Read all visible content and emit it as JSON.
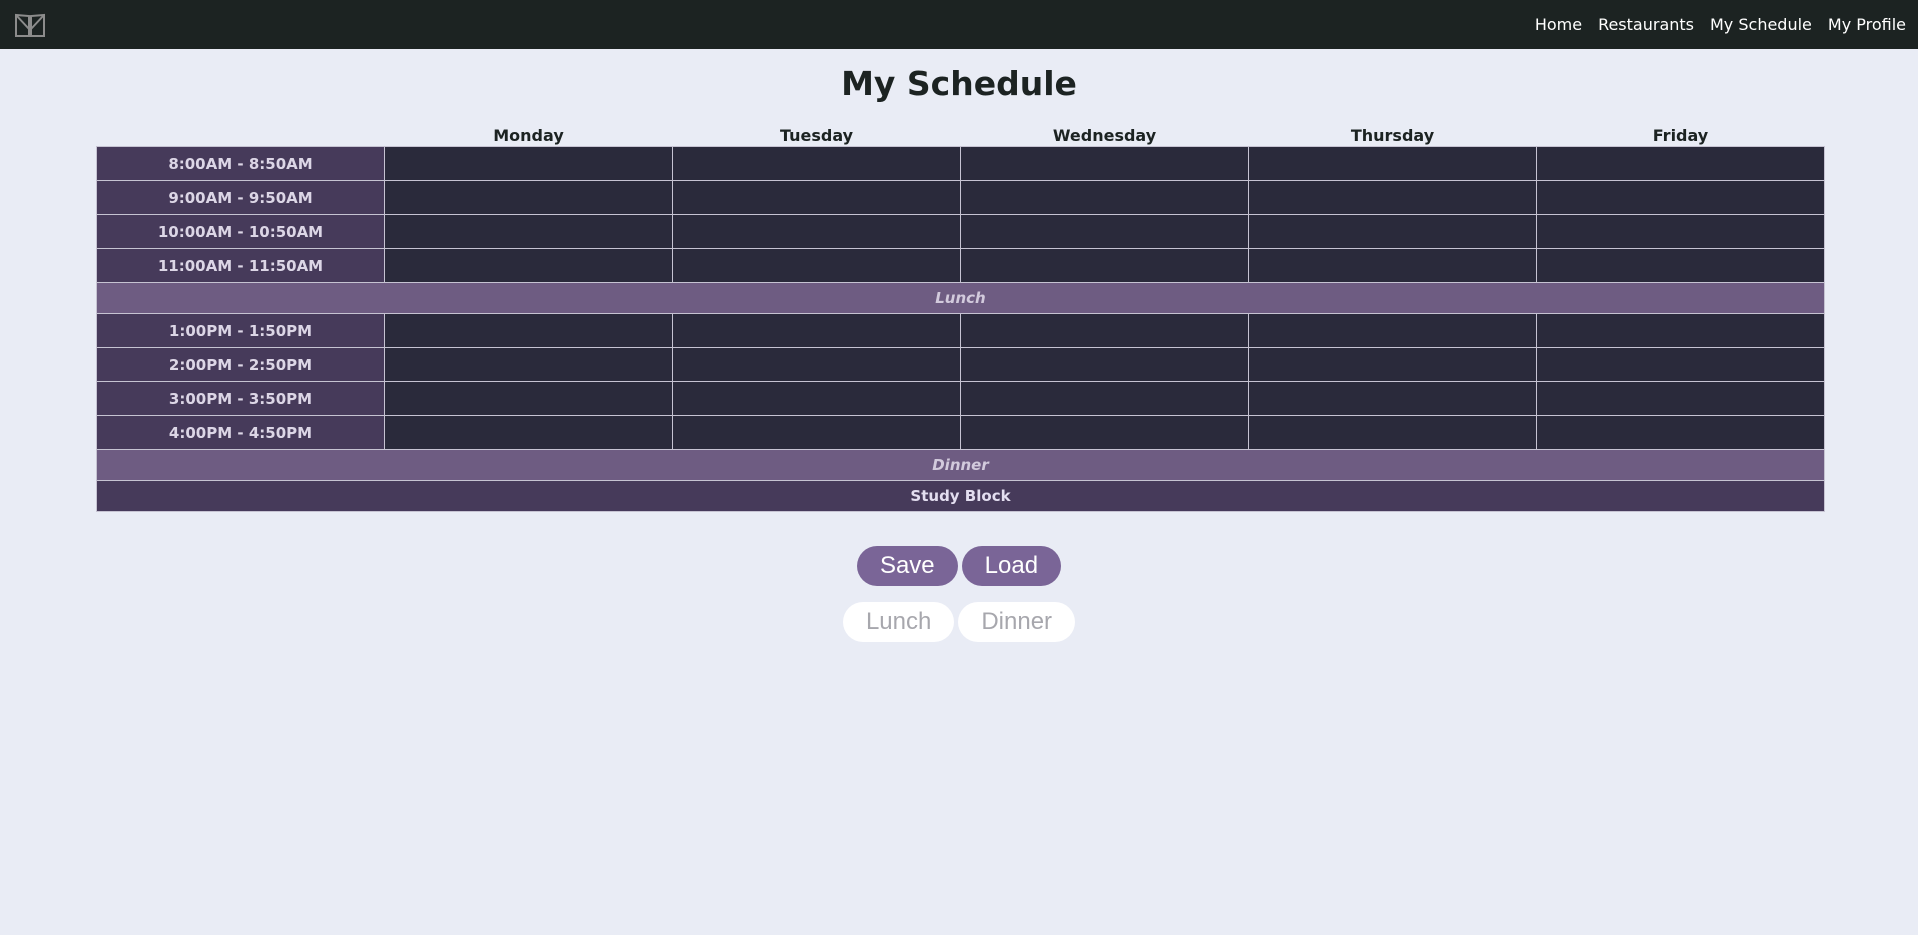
{
  "nav": {
    "logo_icon": "open-book-icon",
    "links": [
      "Home",
      "Restaurants",
      "My Schedule",
      "My Profile"
    ]
  },
  "page": {
    "title": "My Schedule"
  },
  "schedule": {
    "days": [
      "Monday",
      "Tuesday",
      "Wednesday",
      "Thursday",
      "Friday"
    ],
    "morning_slots": [
      "8:00AM - 8:50AM",
      "9:00AM - 9:50AM",
      "10:00AM - 10:50AM",
      "11:00AM - 11:50AM"
    ],
    "lunch_label": "Lunch",
    "afternoon_slots": [
      "1:00PM - 1:50PM",
      "2:00PM - 2:50PM",
      "3:00PM - 3:50PM",
      "4:00PM - 4:50PM"
    ],
    "dinner_label": "Dinner",
    "study_label": "Study Block"
  },
  "actions": {
    "save_label": "Save",
    "load_label": "Load",
    "lunch_label": "Lunch",
    "dinner_label": "Dinner"
  },
  "colors": {
    "navbar": "#1c2322",
    "background": "#e9ecf5",
    "time_cell": "#463a5a",
    "slot_cell": "#2a2a3b",
    "break_row": "#6e5c82",
    "accent_button": "#7a6597"
  }
}
